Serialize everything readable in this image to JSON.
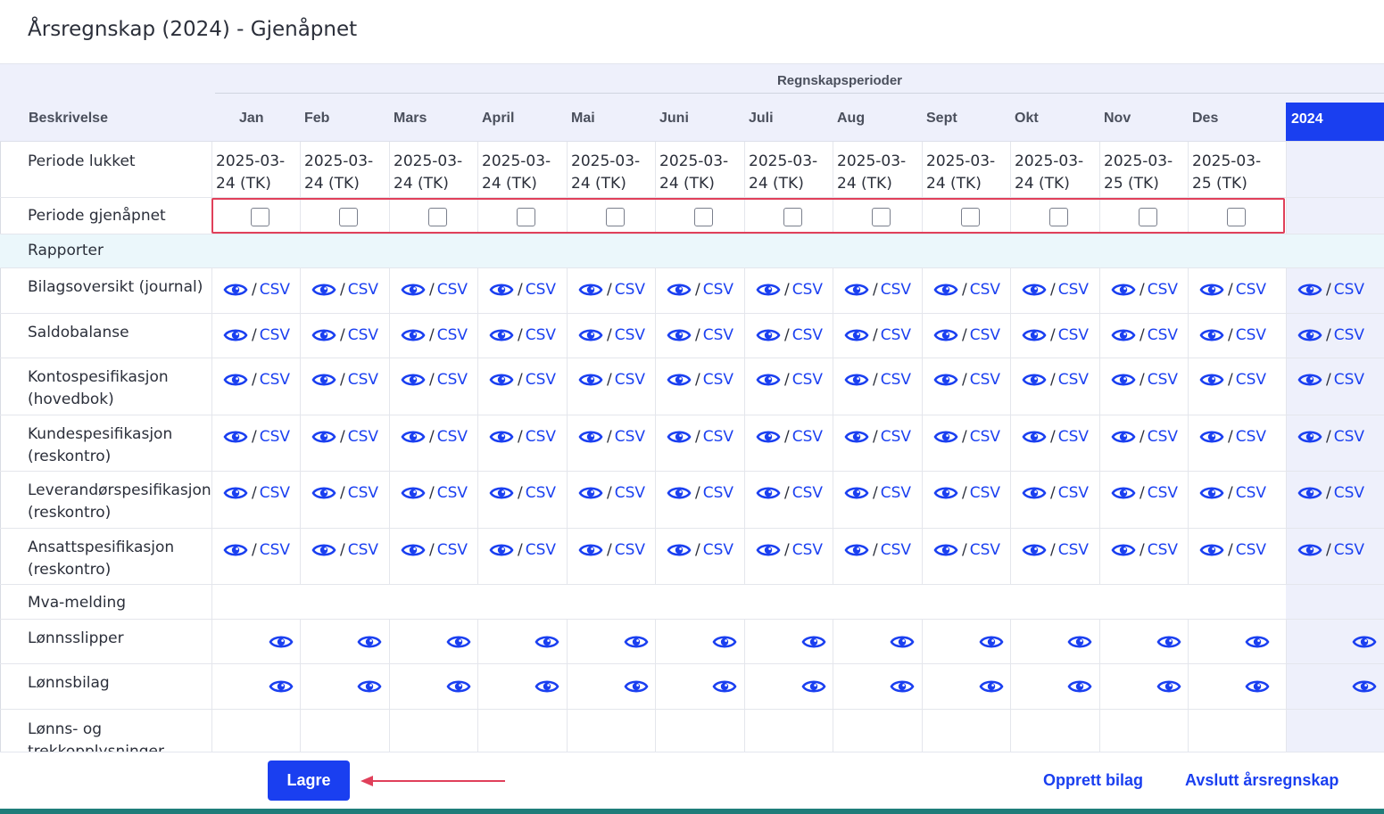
{
  "page": {
    "title": "Årsregnskap (2024) - Gjenåpnet"
  },
  "header": {
    "group_label": "Regnskapsperioder",
    "description_label": "Beskrivelse",
    "months": [
      "Jan",
      "Feb",
      "Mars",
      "April",
      "Mai",
      "Juni",
      "Juli",
      "Aug",
      "Sept",
      "Okt",
      "Nov",
      "Des"
    ],
    "year_label": "2024"
  },
  "rows": {
    "closed": {
      "label": "Periode lukket",
      "dates": [
        [
          "2025-03-",
          "24 (TK)"
        ],
        [
          "2025-03-",
          "24 (TK)"
        ],
        [
          "2025-03-",
          "24 (TK)"
        ],
        [
          "2025-03-",
          "24 (TK)"
        ],
        [
          "2025-03-",
          "24 (TK)"
        ],
        [
          "2025-03-",
          "24 (TK)"
        ],
        [
          "2025-03-",
          "24 (TK)"
        ],
        [
          "2025-03-",
          "24 (TK)"
        ],
        [
          "2025-03-",
          "24 (TK)"
        ],
        [
          "2025-03-",
          "24 (TK)"
        ],
        [
          "2025-03-",
          "25 (TK)"
        ],
        [
          "2025-03-",
          "25 (TK)"
        ]
      ]
    },
    "reopened": {
      "label": "Periode gjenåpnet",
      "checked": [
        false,
        false,
        false,
        false,
        false,
        false,
        false,
        false,
        false,
        false,
        false,
        false
      ]
    },
    "reports_section": {
      "label": "Rapporter"
    },
    "reports": [
      {
        "line1": "Bilagsoversikt (journal)",
        "line2": ""
      },
      {
        "line1": "Saldobalanse",
        "line2": ""
      },
      {
        "line1": "Kontospesifikasjon",
        "line2": "(hovedbok)"
      },
      {
        "line1": "Kundespesifikasjon",
        "line2": "(reskontro)"
      },
      {
        "line1": "Leverandørspesifikasjon",
        "line2": "(reskontro)"
      },
      {
        "line1": "Ansattspesifikasjon",
        "line2": "(reskontro)"
      }
    ],
    "csv_label": "CSV",
    "slash": "/",
    "vat": {
      "label": "Mva-melding"
    },
    "payroll": [
      {
        "line1": "Lønnsslipper"
      },
      {
        "line1": "Lønnsbilag"
      }
    ],
    "partial": {
      "line1": "Lønns- og",
      "line2": "trekkopplysninger"
    }
  },
  "footer": {
    "save_label": "Lagre",
    "create_voucher_label": "Opprett bilag",
    "finish_label": "Avslutt årsregnskap"
  },
  "colors": {
    "accent": "#1a3ff0",
    "highlight": "#e0405a",
    "header_bg": "#eef0fb",
    "section_bg": "#ebf7fb"
  }
}
